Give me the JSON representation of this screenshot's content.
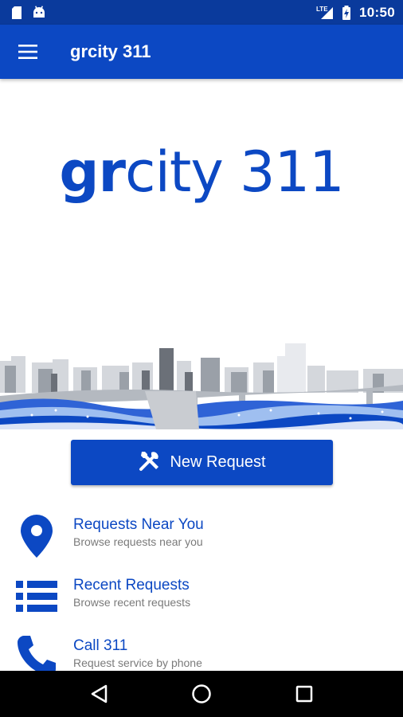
{
  "status_bar": {
    "time": "10:50",
    "network": "LTE",
    "icons": [
      "sd-card-icon",
      "android-icon",
      "signal-icon",
      "battery-charging-icon"
    ]
  },
  "app_bar": {
    "title": "grcity 311",
    "menu_icon": "hamburger-menu-icon"
  },
  "hero": {
    "logo_bold": "gr",
    "logo_light": "city 311"
  },
  "actions": {
    "new_request_label": "New Request",
    "new_request_icon": "tools-icon"
  },
  "menu": {
    "items": [
      {
        "title": "Requests Near You",
        "subtitle": "Browse requests near you",
        "icon": "location-pin-icon"
      },
      {
        "title": "Recent Requests",
        "subtitle": "Browse recent requests",
        "icon": "list-icon"
      },
      {
        "title": "Call 311",
        "subtitle": "Request service by phone",
        "icon": "phone-icon"
      }
    ]
  },
  "nav_bar": {
    "buttons": [
      "back-icon",
      "home-icon",
      "recents-icon"
    ]
  },
  "colors": {
    "status_bar": "#0a3a9c",
    "primary": "#0c48c3",
    "subtitle_text": "#7a7a7a",
    "nav_bar": "#000000"
  }
}
